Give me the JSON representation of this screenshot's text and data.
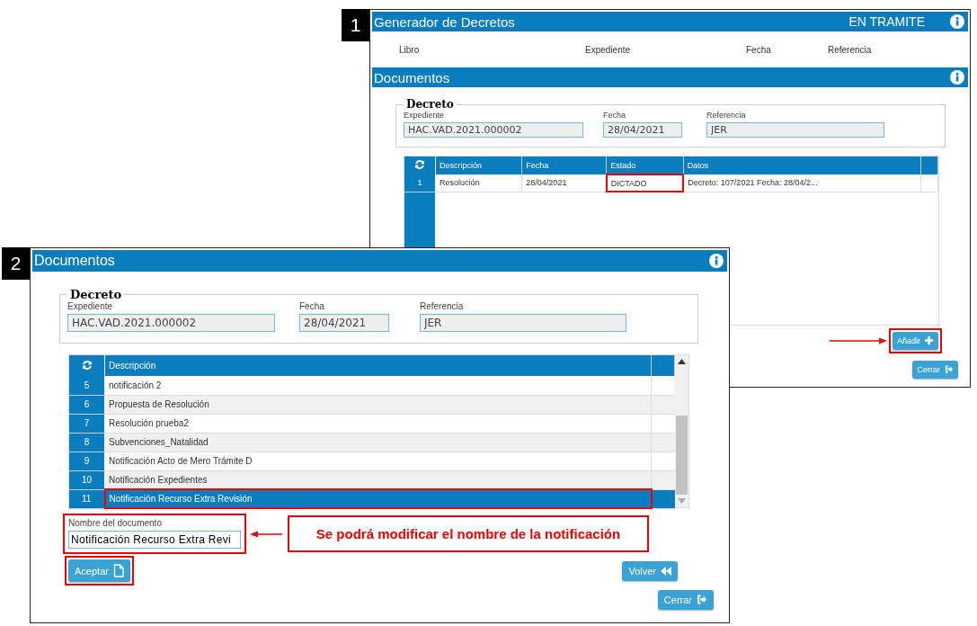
{
  "generator_window": {
    "marker": "1",
    "title": "Generador de Decretos",
    "status": "EN TRAMITE",
    "info_labels": [
      "Libro",
      "Expediente",
      "Fecha",
      "Referencia"
    ],
    "section_title": "Documentos",
    "decreto": {
      "legend": "Decreto",
      "fields": [
        {
          "label": "Expediente",
          "value": "HAC.VAD.2021.000002"
        },
        {
          "label": "Fecha",
          "value": "28/04/2021"
        },
        {
          "label": "Referencia",
          "value": "JER"
        }
      ]
    },
    "table": {
      "columns": [
        "Descripción",
        "Fecha",
        "Estado",
        "Datos"
      ],
      "rows": [
        {
          "number": "1",
          "cells": [
            {
              "text": "Resolución",
              "highlighted": false
            },
            {
              "text": "28/04/2021",
              "highlighted": false
            },
            {
              "text": "DICTADO",
              "highlighted": true
            },
            {
              "text": "Decreto: 107/2021 Fecha: 28/04/2...",
              "highlighted": false
            }
          ]
        }
      ]
    },
    "buttons": [
      {
        "kind": "add",
        "label": "Añadir",
        "highlighted": true,
        "arrow": true
      },
      {
        "kind": "close",
        "label": "Cerrar",
        "highlighted": false,
        "arrow": false
      }
    ]
  },
  "documents_window": {
    "marker": "2",
    "title": "Documentos",
    "decreto": {
      "legend": "Decreto",
      "fields": [
        {
          "label": "Expediente",
          "value": "HAC.VAD.2021.000002"
        },
        {
          "label": "Fecha",
          "value": "28/04/2021"
        },
        {
          "label": "Referencia",
          "value": "JER"
        }
      ]
    },
    "table": {
      "columns": [
        "Descripción"
      ],
      "rows": [
        {
          "number": "5",
          "description": "notificación 2",
          "selected": false,
          "highlighted": false
        },
        {
          "number": "6",
          "description": "Propuesta de Resolución",
          "selected": false,
          "highlighted": false
        },
        {
          "number": "7",
          "description": "Resolución prueba2",
          "selected": false,
          "highlighted": false
        },
        {
          "number": "8",
          "description": "Subvenciones_Natalidad",
          "selected": false,
          "highlighted": false
        },
        {
          "number": "9",
          "description": "Notificación Acto de Mero Trámite D",
          "selected": false,
          "highlighted": false
        },
        {
          "number": "10",
          "description": "Notificación Expedientes",
          "selected": false,
          "highlighted": false
        },
        {
          "number": "11",
          "description": "Notificación Recurso Extra Revisión",
          "selected": true,
          "highlighted": true
        }
      ]
    },
    "name_field": {
      "label": "Nombre del documento",
      "value": "Notificación Recurso Extra Revi",
      "highlighted": true
    },
    "note": "Se podrá modificar el nombre de la notificación",
    "buttons": [
      {
        "kind": "accept",
        "label": "Aceptar",
        "highlighted": true
      },
      {
        "kind": "back",
        "label": "Volver",
        "highlighted": false
      },
      {
        "kind": "close",
        "label": "Cerrar",
        "highlighted": false
      }
    ]
  }
}
